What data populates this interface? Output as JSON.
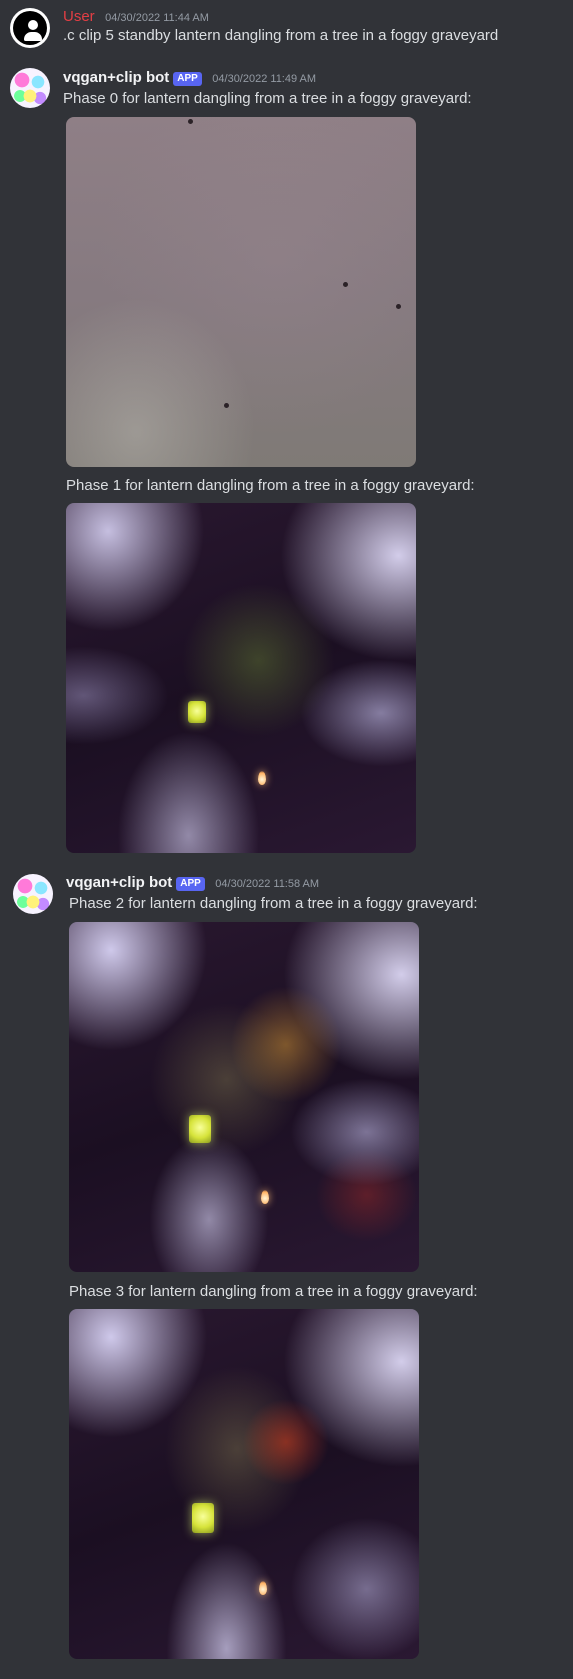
{
  "messages": [
    {
      "author": "User",
      "timestamp": "04/30/2022 11:44 AM",
      "text": ".c clip 5 standby lantern dangling from a tree in a foggy graveyard"
    },
    {
      "author": "vqgan+clip bot",
      "badge": "APP",
      "timestamp": "04/30/2022 11:49 AM",
      "captions": [
        "Phase 0 for lantern dangling from a tree in a foggy graveyard:",
        "Phase 1 for lantern dangling from a tree in a foggy graveyard:"
      ]
    },
    {
      "author": "vqgan+clip bot",
      "badge": "APP",
      "timestamp": "04/30/2022 11:58 AM",
      "captions": [
        "Phase 2 for lantern dangling from a tree in a foggy graveyard:",
        "Phase 3 for lantern dangling from a tree in a foggy graveyard:"
      ]
    }
  ],
  "colors": {
    "background": "#313338",
    "user_name": "#e33e44",
    "app_badge": "#5865f2",
    "timestamp": "#949ba4",
    "text": "#dbdee1"
  }
}
